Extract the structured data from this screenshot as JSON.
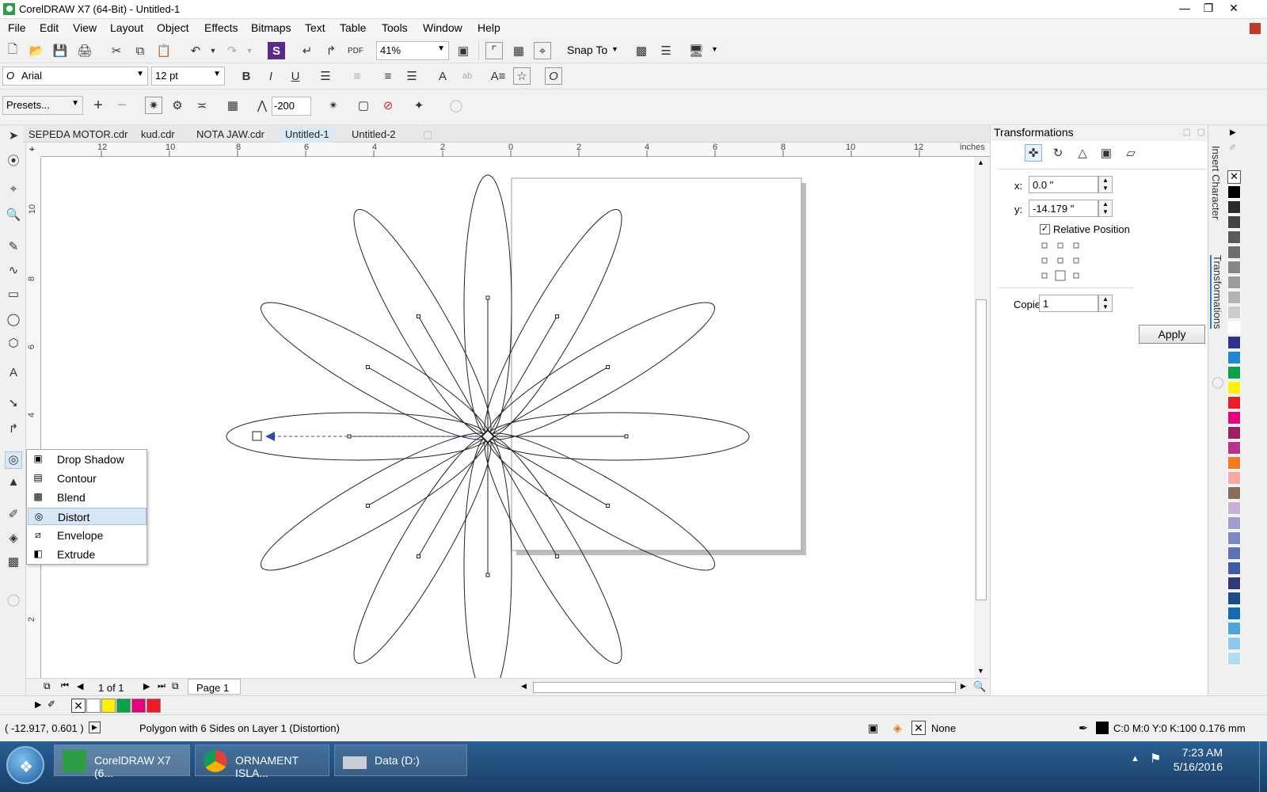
{
  "window": {
    "title": "CorelDRAW X7 (64-Bit) - Untitled-1"
  },
  "menu": [
    "File",
    "Edit",
    "View",
    "Layout",
    "Object",
    "Effects",
    "Bitmaps",
    "Text",
    "Table",
    "Tools",
    "Window",
    "Help"
  ],
  "standard_toolbar": {
    "zoom": "41%",
    "snap_label": "Snap To"
  },
  "property_bar": {
    "font": "Arial",
    "size": "12 pt",
    "presets": "Presets...",
    "amplitude": "-200"
  },
  "doc_tabs": [
    "SEPEDA MOTOR.cdr",
    "kud.cdr",
    "NOTA JAW.cdr",
    "Untitled-1",
    "Untitled-2"
  ],
  "ruler": {
    "units": "inches",
    "h_labels": [
      "12",
      "10",
      "8",
      "6",
      "4",
      "2",
      "0",
      "2",
      "4",
      "6",
      "8",
      "10",
      "12"
    ],
    "v_labels": [
      "10",
      "8",
      "6",
      "4",
      "2"
    ]
  },
  "flyout": {
    "items": [
      {
        "label": "Drop Shadow",
        "icon": "drop-shadow-icon"
      },
      {
        "label": "Contour",
        "icon": "contour-icon"
      },
      {
        "label": "Blend",
        "icon": "blend-icon"
      },
      {
        "label": "Distort",
        "icon": "distort-icon"
      },
      {
        "label": "Envelope",
        "icon": "envelope-icon"
      },
      {
        "label": "Extrude",
        "icon": "extrude-icon"
      }
    ],
    "selected": "Distort"
  },
  "docker": {
    "title": "Transformations",
    "x_label": "x:",
    "x_value": "0.0 \"",
    "y_label": "y:",
    "y_value": "-14.179 \"",
    "relative_label": "Relative Position",
    "copies_label": "Copies:",
    "copies_value": "1",
    "apply_label": "Apply",
    "side_tabs": [
      "Insert Character",
      "Transformations"
    ]
  },
  "page_nav": {
    "counter": "1 of 1",
    "page_tab": "Page 1"
  },
  "status": {
    "coords": "( -12.917, 0.601 )",
    "message": "Polygon with 6 Sides on Layer 1 (Distortion)",
    "fill": "None",
    "outline": "C:0 M:0 Y:0 K:100  0.176 mm"
  },
  "palette_colors": [
    "#000000",
    "#2b2b2b",
    "#444444",
    "#5a5a5a",
    "#707070",
    "#878787",
    "#9c9c9c",
    "#b4b4b4",
    "#cccccc",
    "#ffffff",
    "#2e3191",
    "#1e88d8",
    "#0aa14b",
    "#fef200",
    "#ed1c24",
    "#e6007e",
    "#9e1f63",
    "#b8338f",
    "#f47b20",
    "#f7a8a2",
    "#8b6d5c",
    "#c8b0d6",
    "#a19dd1",
    "#7c89c7",
    "#5c73b8",
    "#3d5ba8",
    "#2e3a7a",
    "#1a4d8c",
    "#0d6eb6",
    "#4ba7e0",
    "#8cc9ed",
    "#b3dcf2"
  ],
  "bottom_palette": [
    "#ffffff",
    "#fef200",
    "#0aa14b",
    "#e6007e",
    "#ed1c24"
  ],
  "taskbar": {
    "tasks": [
      "CorelDRAW X7 (6...",
      "ORNAMENT ISLA...",
      "Data (D:)"
    ],
    "time": "7:23 AM",
    "date": "5/16/2016"
  }
}
